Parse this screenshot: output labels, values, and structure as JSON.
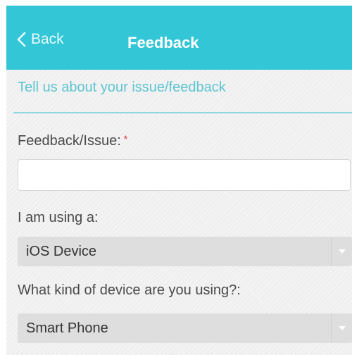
{
  "header": {
    "back_label": "Back",
    "title": "Feedback"
  },
  "form": {
    "subtitle": "Tell us about your issue/feedback",
    "feedback": {
      "label": "Feedback/Issue:",
      "required_marker": "*",
      "value": "",
      "placeholder": ""
    },
    "using": {
      "label": "I am using a:",
      "selected": "iOS Device"
    },
    "device_kind": {
      "label": "What kind of device are you using?:",
      "selected": "Smart Phone"
    }
  },
  "colors": {
    "header_bg": "#33c6d6",
    "accent_text": "#5ec5d2",
    "required": "#e03030",
    "select_bg": "#dedede"
  },
  "icons": {
    "back": "chevron-left-icon",
    "dropdown": "caret-down-icon"
  }
}
